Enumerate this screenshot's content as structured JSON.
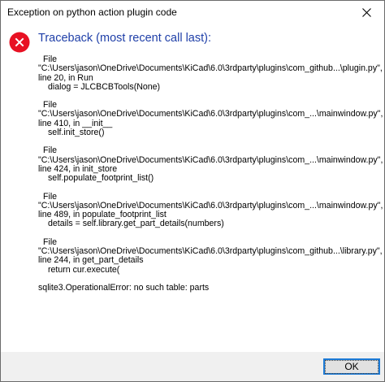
{
  "window": {
    "title": "Exception on python action plugin code"
  },
  "dialog": {
    "heading": "Traceback (most recent call last):",
    "frames": [
      {
        "file_label": "File",
        "path": "\"C:\\Users\\jason\\OneDrive\\Documents\\KiCad\\6.0\\3rdparty\\plugins\\com_github...\\plugin.py\",",
        "location": "line 20, in Run",
        "code": "dialog = JLCBCBTools(None)"
      },
      {
        "file_label": "File",
        "path": "\"C:\\Users\\jason\\OneDrive\\Documents\\KiCad\\6.0\\3rdparty\\plugins\\com_...\\mainwindow.py\",",
        "location": "line 410, in __init__",
        "code": "self.init_store()"
      },
      {
        "file_label": "File",
        "path": "\"C:\\Users\\jason\\OneDrive\\Documents\\KiCad\\6.0\\3rdparty\\plugins\\com_...\\mainwindow.py\",",
        "location": "line 424, in init_store",
        "code": "self.populate_footprint_list()"
      },
      {
        "file_label": "File",
        "path": "\"C:\\Users\\jason\\OneDrive\\Documents\\KiCad\\6.0\\3rdparty\\plugins\\com_...\\mainwindow.py\",",
        "location": "line 489, in populate_footprint_list",
        "code": "details = self.library.get_part_details(numbers)"
      },
      {
        "file_label": "File",
        "path": "\"C:\\Users\\jason\\OneDrive\\Documents\\KiCad\\6.0\\3rdparty\\plugins\\com_github...\\library.py\",",
        "location": "line 244, in get_part_details",
        "code": "return cur.execute("
      }
    ],
    "error_message": "sqlite3.OperationalError: no such table: parts",
    "ok_label": "OK"
  },
  "icons": {
    "error": "error-icon",
    "close": "close-icon"
  },
  "colors": {
    "heading": "#1f3fa8",
    "error_icon": "#e81123",
    "footer_bg": "#f0f0f0",
    "button_border": "#1c7ad6"
  }
}
